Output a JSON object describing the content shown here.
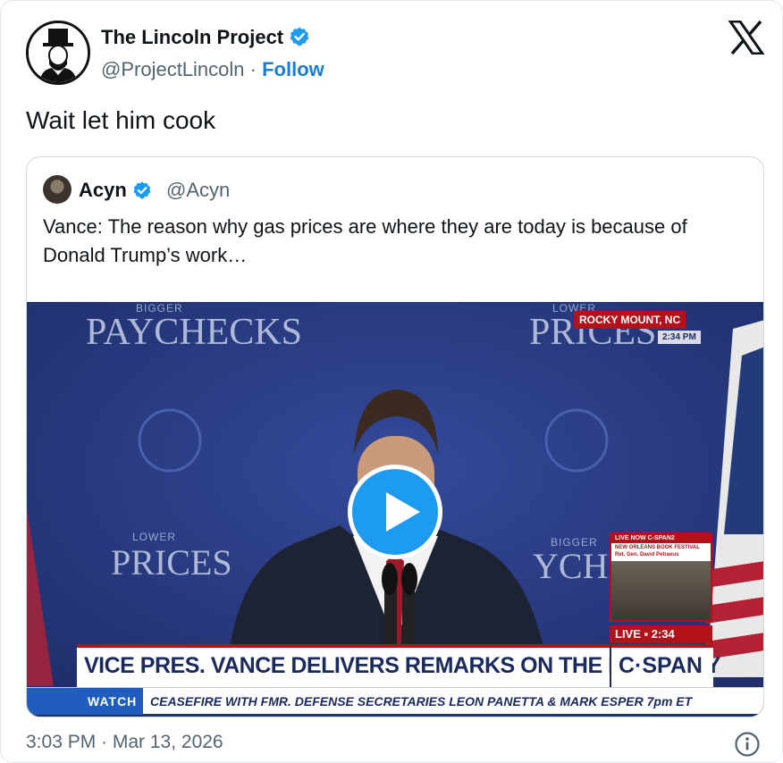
{
  "tweet": {
    "author_name": "The Lincoln Project",
    "handle": "@ProjectLincoln",
    "separator": "·",
    "follow_label": "Follow",
    "text": "Wait let him cook",
    "timestamp": "3:03 PM · Mar 13, 2026",
    "verified_color": "#1d9bf0",
    "accent_color": "#1d7bd8"
  },
  "quote": {
    "author_name": "Acyn",
    "handle": "@Acyn",
    "text": "Vance: The reason why gas prices are where they are today is because of Donald Trump’s work…"
  },
  "video": {
    "backdrop_top_left_small": "BIGGER",
    "backdrop_top_left": "PAYCHECKS",
    "backdrop_top_right_small": "LOWER",
    "backdrop_top_right": "PRICES",
    "backdrop_mid_left_small": "LOWER",
    "backdrop_mid_left": "PRICES",
    "backdrop_mid_right_small": "BIGGER",
    "backdrop_mid_right": "YCHE",
    "location": "ROCKY MOUNT, NC",
    "location_time": "2:34 PM",
    "pip_header": "LIVE NOW C-SPAN2",
    "pip_line1": "NEW ORLEANS BOOK FESTIVAL",
    "pip_line2": "Ret. Gen. David Petraeus",
    "live_label": "LIVE ▪ 2:34",
    "lower_third": "VICE PRES. VANCE DELIVERS REMARKS ON THE ECONOMY",
    "network": "C·SPAN",
    "watch_label": "WATCH",
    "ticker": "CEASEFIRE WITH FMR. DEFENSE SECRETARIES LEON PANETTA & MARK ESPER  7pm ET"
  },
  "icons": {
    "verified": "verified-badge-icon",
    "x_logo": "x-logo-icon",
    "play": "play-icon",
    "info": "info-icon"
  }
}
